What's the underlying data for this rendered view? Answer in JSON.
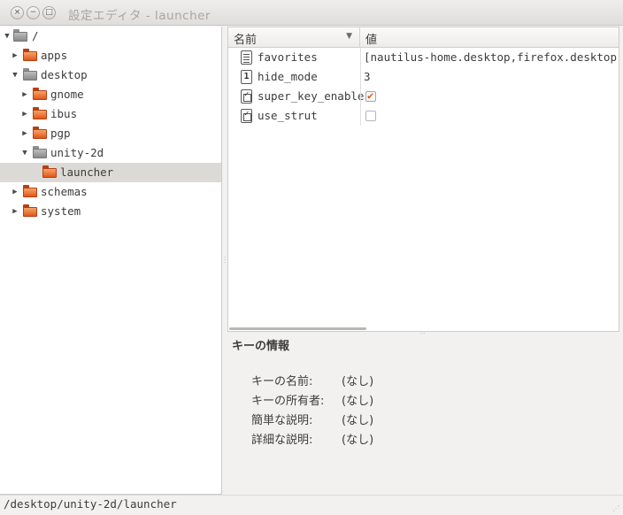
{
  "window": {
    "title": "設定エディタ - launcher",
    "close_glyph": "×",
    "minimize_glyph": "−",
    "maximize_glyph": "□"
  },
  "tree": {
    "expanded_glyph": "▼",
    "collapsed_glyph": "▶",
    "items": [
      {
        "label": "/",
        "expander": "expanded",
        "folder": "grey"
      },
      {
        "label": "apps",
        "expander": "collapsed",
        "folder": "orange"
      },
      {
        "label": "desktop",
        "expander": "expanded",
        "folder": "grey"
      },
      {
        "label": "gnome",
        "expander": "collapsed",
        "folder": "orange"
      },
      {
        "label": "ibus",
        "expander": "collapsed",
        "folder": "orange"
      },
      {
        "label": "pgp",
        "expander": "collapsed",
        "folder": "orange"
      },
      {
        "label": "unity-2d",
        "expander": "expanded",
        "folder": "grey"
      },
      {
        "label": "launcher",
        "expander": "none",
        "folder": "orange",
        "selected": true
      },
      {
        "label": "schemas",
        "expander": "collapsed",
        "folder": "orange"
      },
      {
        "label": "system",
        "expander": "collapsed",
        "folder": "orange"
      }
    ]
  },
  "keys": {
    "header": {
      "name": "名前",
      "value": "値",
      "sort_glyph": "▼"
    },
    "rows": [
      {
        "name": "favorites",
        "type": "list",
        "value": "[nautilus-home.desktop,firefox.desktop,goo"
      },
      {
        "name": "hide_mode",
        "type": "int",
        "type_glyph": "1",
        "value": "3"
      },
      {
        "name": "super_key_enable",
        "type": "bool",
        "checked": true
      },
      {
        "name": "use_strut",
        "type": "bool",
        "checked": false
      }
    ]
  },
  "key_info": {
    "title": "キーの情報",
    "rows": [
      {
        "label": "キーの名前:",
        "value": "(なし)"
      },
      {
        "label": "キーの所有者:",
        "value": "(なし)"
      },
      {
        "label": "簡単な説明:",
        "value": "(なし)"
      },
      {
        "label": "詳細な説明:",
        "value": "(なし)"
      }
    ]
  },
  "status": {
    "path": "/desktop/unity-2d/launcher"
  },
  "colors": {
    "accent": "#e0561c",
    "selection": "#dcdad6"
  }
}
